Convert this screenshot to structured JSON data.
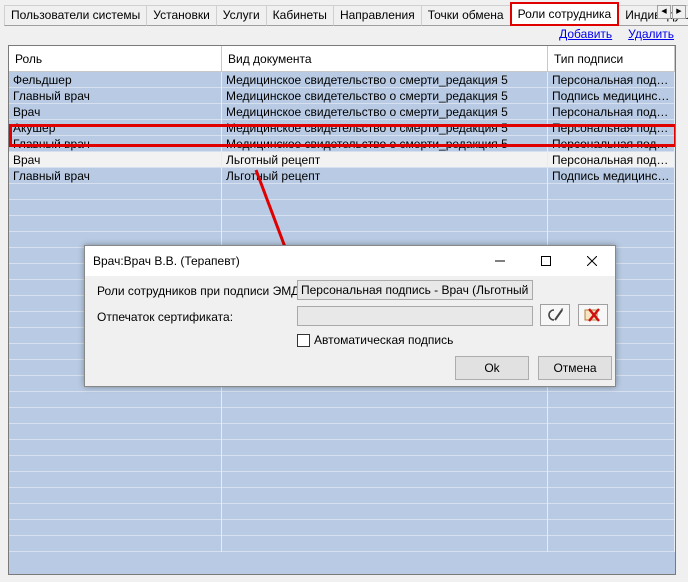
{
  "tabs": [
    {
      "label": "Пользователи системы",
      "name": "tab-users"
    },
    {
      "label": "Установки",
      "name": "tab-settings"
    },
    {
      "label": "Услуги",
      "name": "tab-services"
    },
    {
      "label": "Кабинеты",
      "name": "tab-cabinets"
    },
    {
      "label": "Направления",
      "name": "tab-directions"
    },
    {
      "label": "Точки обмена",
      "name": "tab-exchange-points"
    },
    {
      "label": "Роли сотрудника",
      "name": "tab-employee-roles"
    },
    {
      "label": "Индивидуальные",
      "name": "tab-individual"
    }
  ],
  "links": {
    "add": "Добавить",
    "delete": "Удалить"
  },
  "grid": {
    "headers": [
      "Роль",
      "Вид документа",
      "Тип подписи"
    ],
    "rows": [
      [
        "Фельдшер",
        "Медицинское свидетельство о смерти_редакция 5",
        "Персональная подпись"
      ],
      [
        "Главный врач",
        "Медицинское свидетельство о смерти_редакция 5",
        "Подпись медицинской организации"
      ],
      [
        "Врач",
        "Медицинское свидетельство о смерти_редакция 5",
        "Персональная подпись"
      ],
      [
        "Акушер",
        "Медицинское свидетельство о смерти_редакция 5",
        "Персональная подпись"
      ],
      [
        "Главный врач",
        "Медицинское свидетельство о смерти_редакция 5",
        "Персональная подпись"
      ],
      [
        "Врач",
        "Льготный рецепт",
        "Персональная подпись"
      ],
      [
        "Главный врач",
        "Льготный рецепт",
        "Подпись медицинской организации"
      ]
    ],
    "selected_index": 5
  },
  "dialog": {
    "title": "Врач:Врач В.В. (Терапевт)",
    "roles_label": "Роли сотрудников при подписи ЭМД:",
    "roles_value": "Персональная подпись - Врач (Льготный рецепт)",
    "cert_label": "Отпечаток сертификата:",
    "cert_value": "",
    "auto_sign_label": "Автоматическая подпись",
    "auto_sign_checked": false,
    "ok_label": "Ok",
    "cancel_label": "Отмена"
  },
  "colors": {
    "highlight": "#e00000",
    "grid_bg": "#b9cbe4",
    "link": "#0000ee"
  }
}
